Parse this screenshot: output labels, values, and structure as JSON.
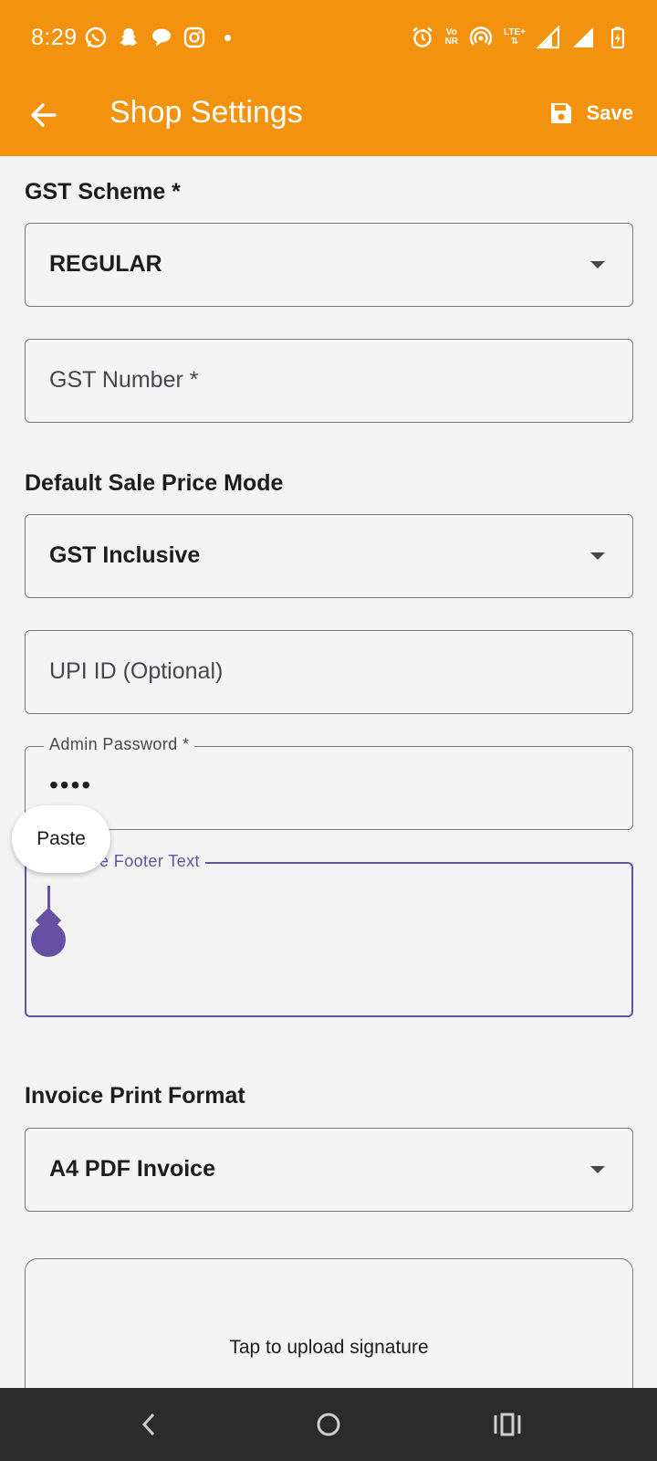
{
  "status_bar": {
    "time": "8:29",
    "left_icons": [
      "whatsapp-icon",
      "snapchat-icon",
      "chat-bubble-icon",
      "instagram-icon",
      "notification-dot-icon"
    ],
    "right_icons": [
      "alarm-icon",
      "vonr-icon",
      "hotspot-icon",
      "lte-plus-icon",
      "signal-icon",
      "signal-icon",
      "battery-charging-icon"
    ],
    "vonr_top": "Vo",
    "vonr_bottom": "NR",
    "lte_label": "LTE+"
  },
  "app_bar": {
    "title": "Shop Settings",
    "save_label": "Save",
    "background_color": "#f2920f"
  },
  "form": {
    "gst_scheme": {
      "label": "GST Scheme *",
      "value": "REGULAR"
    },
    "gst_number": {
      "placeholder": "GST Number *"
    },
    "sale_price_mode": {
      "label": "Default Sale Price Mode",
      "value": "GST Inclusive"
    },
    "upi_id": {
      "placeholder": "UPI ID (Optional)"
    },
    "admin_password": {
      "label": "Admin Password *",
      "value": "••••"
    },
    "invoice_footer": {
      "label": "e Footer Text",
      "value": ""
    },
    "print_format": {
      "label": "Invoice Print Format",
      "value": "A4 PDF Invoice"
    },
    "signature": {
      "text": "Tap to upload signature"
    }
  },
  "context_menu": {
    "paste_label": "Paste"
  },
  "accent_color": "#6750a4"
}
